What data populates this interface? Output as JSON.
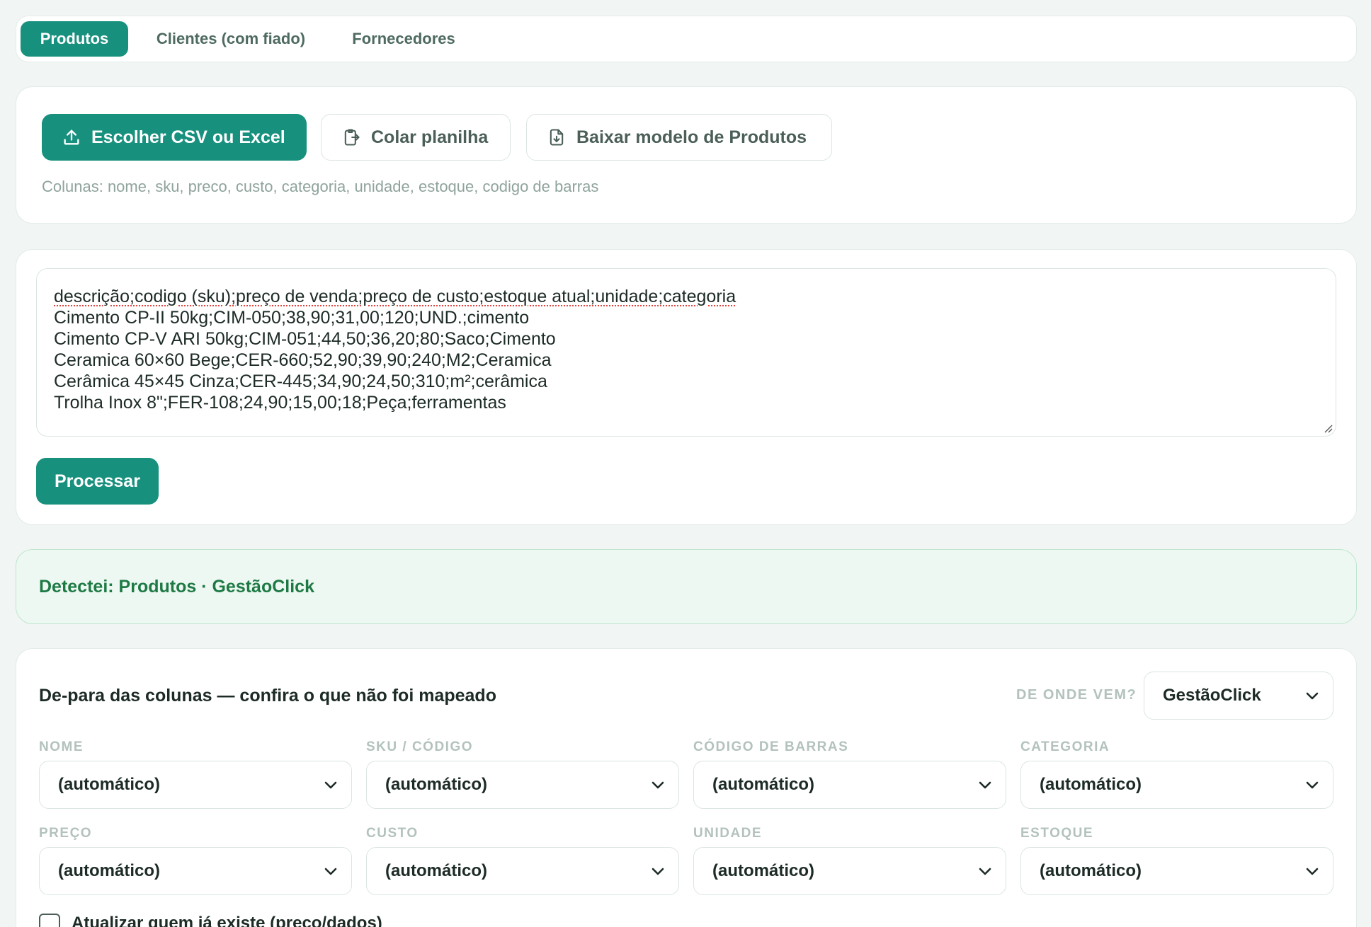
{
  "tabs": [
    "Produtos",
    "Clientes (com fiado)",
    "Fornecedores"
  ],
  "import": {
    "choose_label": "Escolher CSV ou Excel",
    "paste_label": "Colar planilha",
    "template_label": "Baixar modelo de Produtos",
    "hint": "Colunas: nome, sku, preco, custo, categoria, unidade, estoque, codigo de barras"
  },
  "paste": {
    "lines": [
      "descrição;codigo (sku);preço de venda;preço de custo;estoque atual;unidade;categoria",
      "Cimento CP-II 50kg;CIM-050;38,90;31,00;120;UND.;cimento",
      "Cimento CP-V ARI 50kg;CIM-051;44,50;36,20;80;Saco;Cimento",
      "Ceramica 60×60 Bege;CER-660;52,90;39,90;240;M2;Ceramica",
      "Cerâmica 45×45 Cinza;CER-445;34,90;24,50;310;m²;cerâmica",
      "Trolha Inox 8\";FER-108;24,90;15,00;18;Peça;ferramentas"
    ],
    "process_label": "Processar"
  },
  "detect": {
    "text": "Detectei: Produtos · GestãoClick"
  },
  "mapping": {
    "title": "De-para das colunas — confira o que não foi mapeado",
    "source_label": "DE ONDE VEM?",
    "source_value": "GestãoClick",
    "fields": [
      {
        "label": "NOME",
        "value": "(automático)"
      },
      {
        "label": "SKU / CÓDIGO",
        "value": "(automático)"
      },
      {
        "label": "CÓDIGO DE BARRAS",
        "value": "(automático)"
      },
      {
        "label": "CATEGORIA",
        "value": "(automático)"
      },
      {
        "label": "PREÇO",
        "value": "(automático)"
      },
      {
        "label": "CUSTO",
        "value": "(automático)"
      },
      {
        "label": "UNIDADE",
        "value": "(automático)"
      },
      {
        "label": "ESTOQUE",
        "value": "(automático)"
      }
    ],
    "update_label": "Atualizar quem já existe (preço/dados)"
  },
  "colors": {
    "accent": "#18907e",
    "success_text": "#1e7a45",
    "success_bg": "#eef8f2"
  }
}
